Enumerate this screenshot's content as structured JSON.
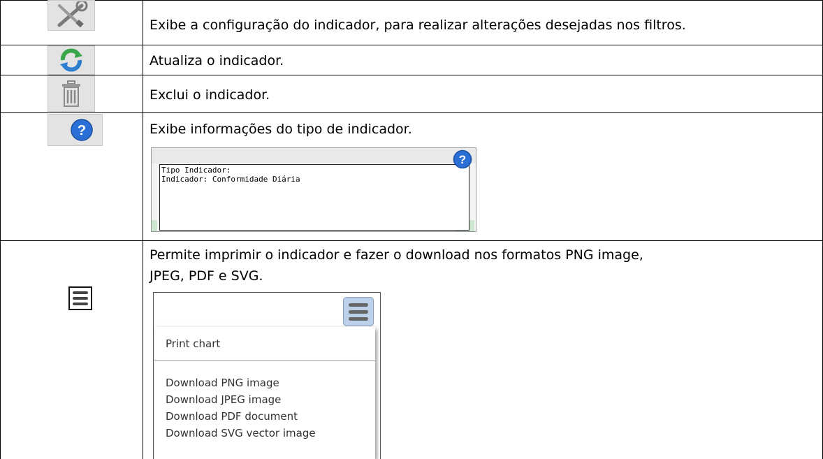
{
  "rows": [
    {
      "icon": "wrench-screwdriver-icon",
      "text": "Exibe a configuração do indicador, para realizar alterações desejadas nos filtros."
    },
    {
      "icon": "refresh-icon",
      "text": "Atualiza o indicador."
    },
    {
      "icon": "trash-icon",
      "text": "Exclui o indicador."
    },
    {
      "icon": "help-icon",
      "text": "Exibe informações do tipo de indicador."
    },
    {
      "icon": "hamburger-menu-icon",
      "text_line1": "Permite imprimir o indicador e fazer o download nos formatos PNG image,",
      "text_line2": "JPEG, PDF e SVG."
    }
  ],
  "info_popup": {
    "line1": "Tipo Indicador:",
    "line2": "Indicador: Conformidade Diária"
  },
  "export_menu": {
    "print": "Print chart",
    "png": "Download PNG image",
    "jpeg": "Download JPEG image",
    "pdf": "Download PDF document",
    "svg": "Download SVG vector image"
  },
  "colors": {
    "refresh_green": "#3aa64a",
    "refresh_blue": "#2f7fd0",
    "help_blue": "#2a6fd6",
    "menu_button_bg": "#bcd0ea"
  }
}
